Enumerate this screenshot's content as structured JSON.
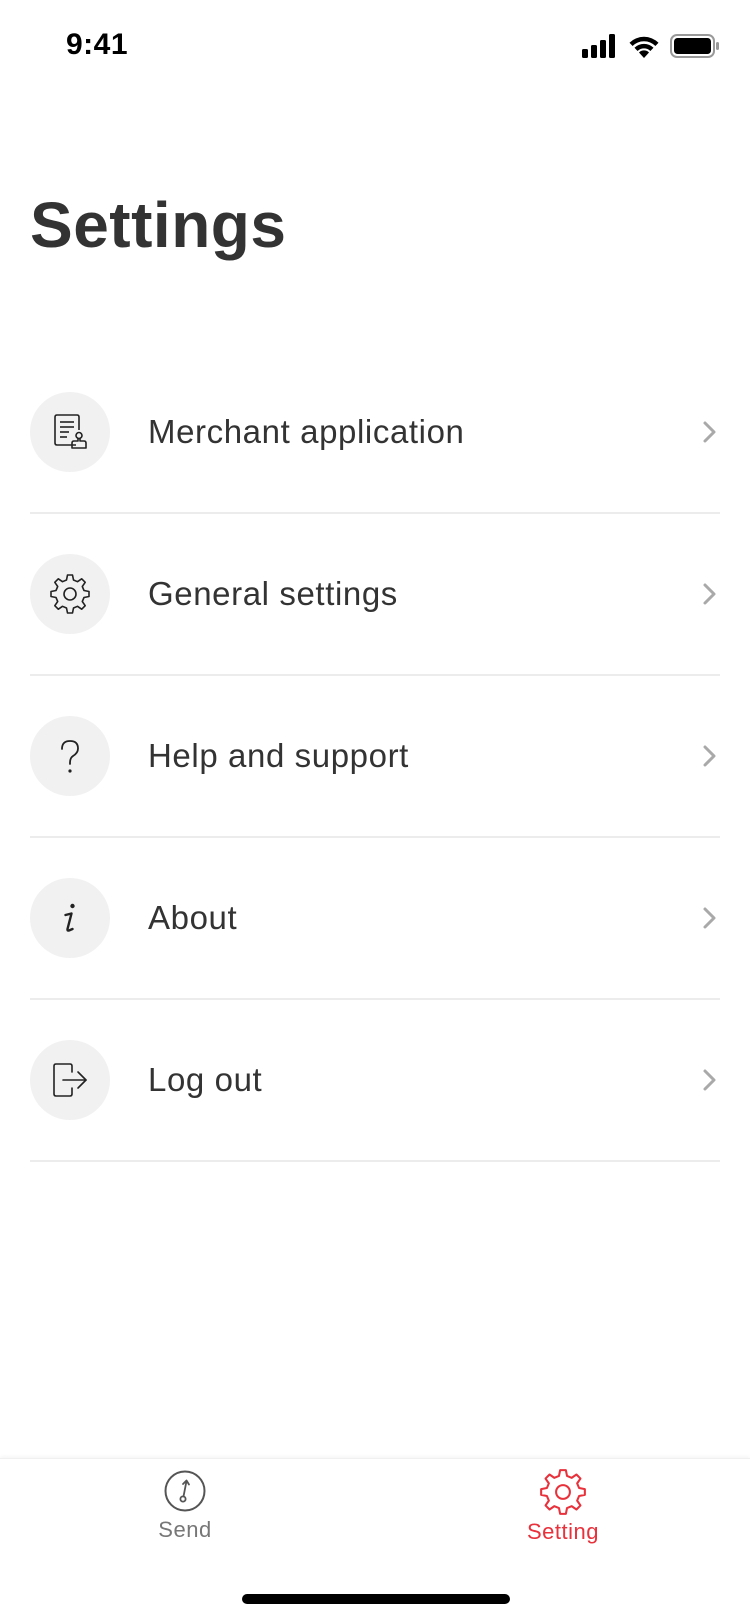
{
  "status": {
    "time": "9:41"
  },
  "page": {
    "title": "Settings"
  },
  "menu": {
    "items": [
      {
        "label": "Merchant application",
        "icon": "merchant-application-icon"
      },
      {
        "label": "General settings",
        "icon": "gear-icon"
      },
      {
        "label": "Help and support",
        "icon": "question-icon"
      },
      {
        "label": "About",
        "icon": "info-icon"
      },
      {
        "label": "Log out",
        "icon": "logout-icon"
      }
    ]
  },
  "tabs": {
    "send": {
      "label": "Send",
      "icon": "send-icon",
      "active": false
    },
    "setting": {
      "label": "Setting",
      "icon": "gear-icon",
      "active": true
    }
  },
  "colors": {
    "accent": "#e8313b",
    "text": "#333333",
    "muted": "#777777",
    "icon_bg": "#f1f1f1"
  }
}
